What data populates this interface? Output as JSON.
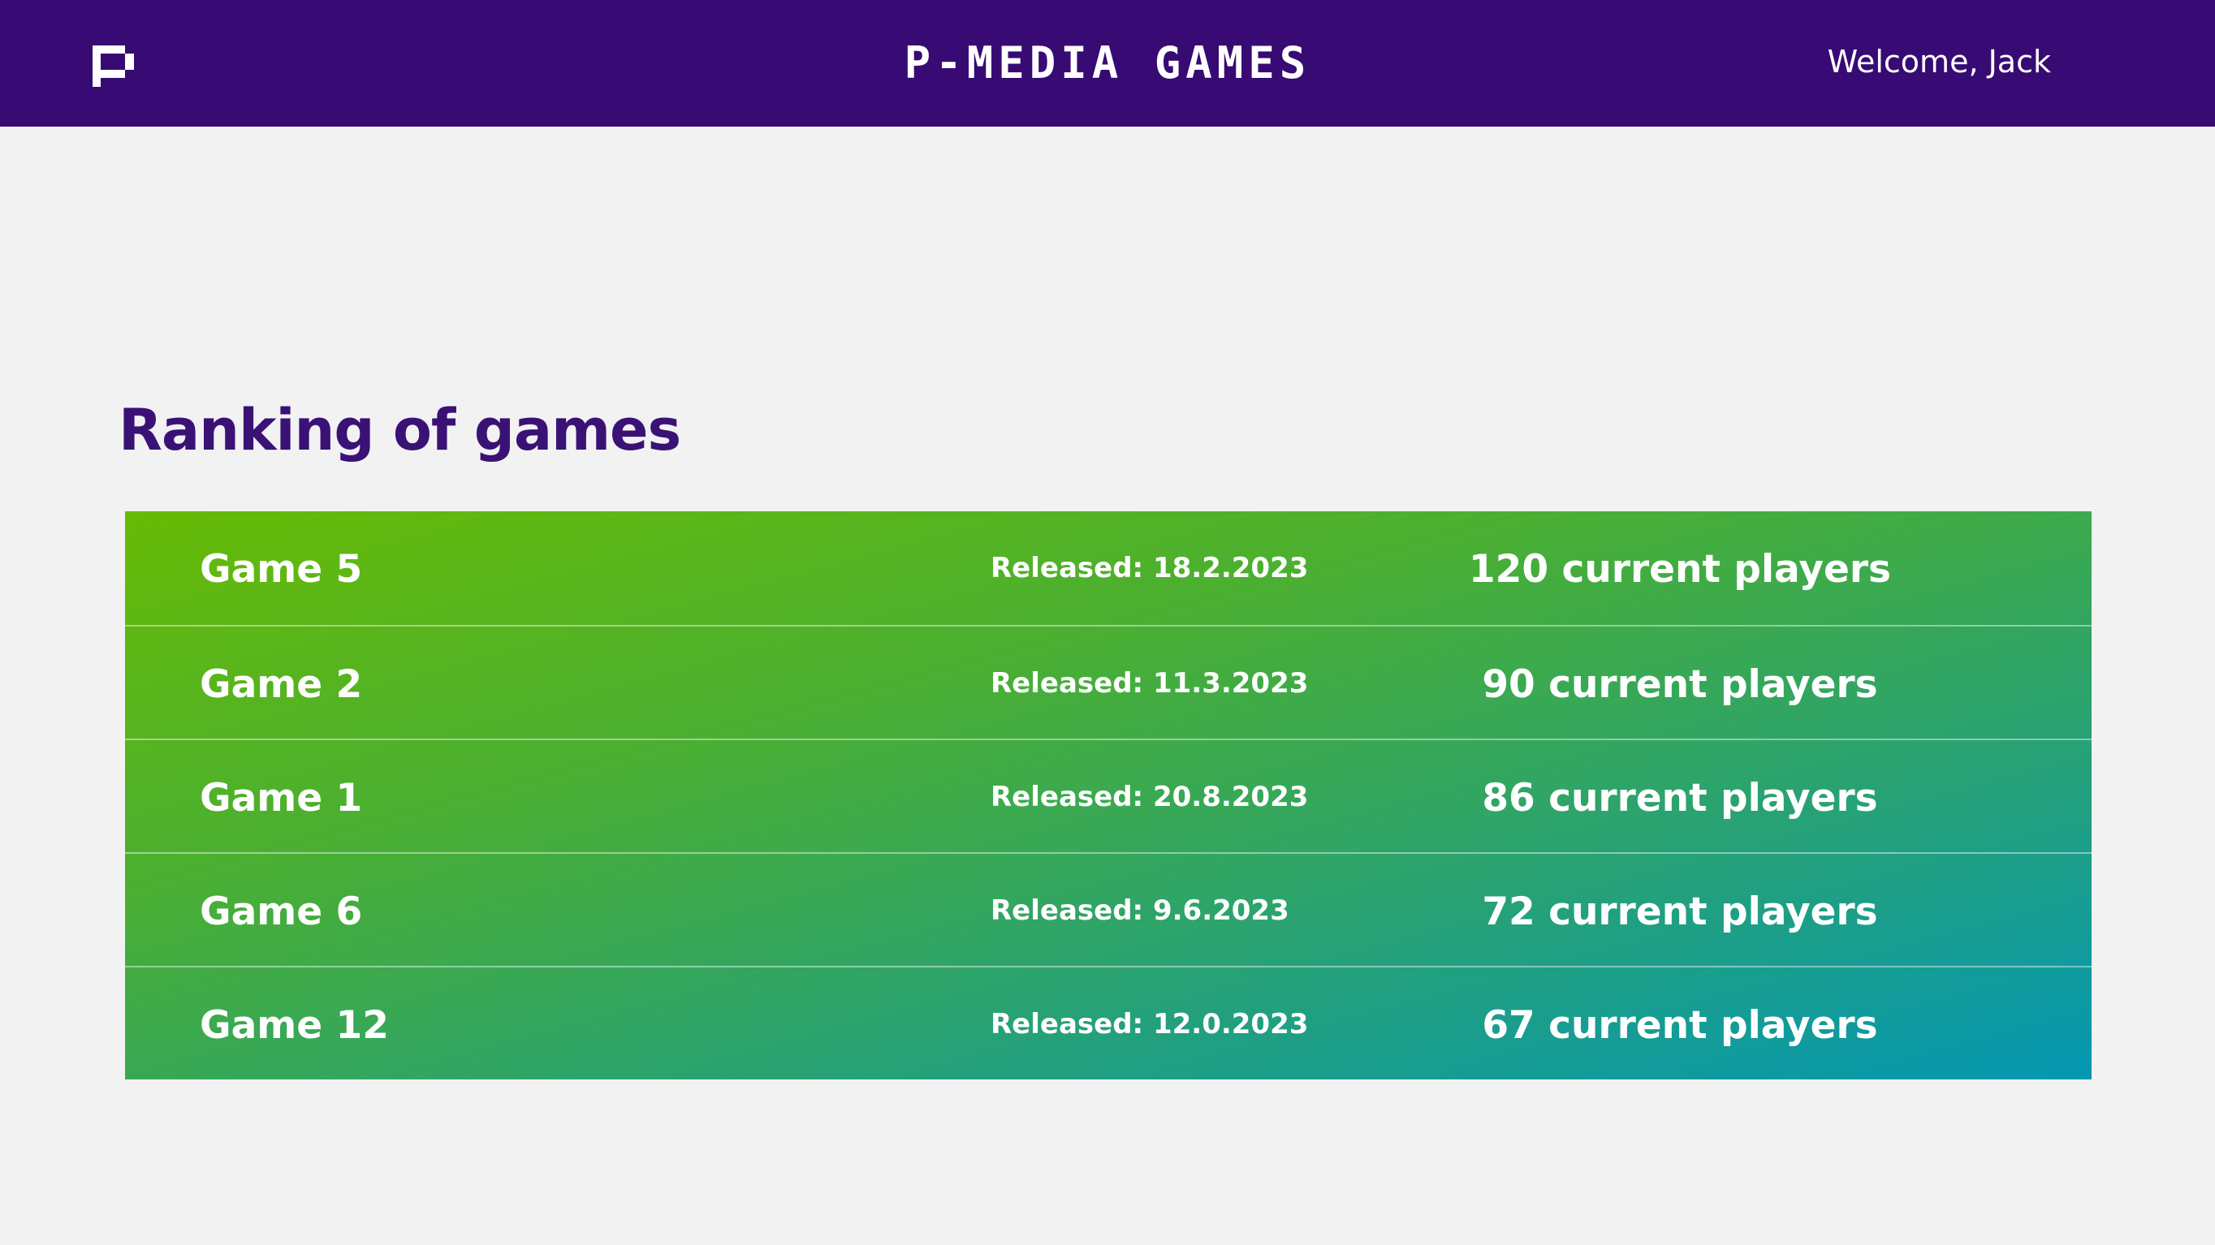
{
  "header": {
    "logo_icon": "p-logo-icon",
    "brand": "P-MEDIA GAMES",
    "welcome": "Welcome, Jack"
  },
  "main": {
    "title": "Ranking of games",
    "colors": {
      "header_bg": "#370b73",
      "title": "#3a1276",
      "gradient_top": "#67bb05",
      "gradient_bottom": "#0497b2"
    },
    "games": [
      {
        "name": "Game 5",
        "released": "Released: 18.2.2023",
        "players": "120 current players"
      },
      {
        "name": "Game 2",
        "released": "Released: 11.3.2023",
        "players": "90 current players"
      },
      {
        "name": "Game 1",
        "released": "Released: 20.8.2023",
        "players": "86 current players"
      },
      {
        "name": "Game 6",
        "released": "Released: 9.6.2023",
        "players": "72 current players"
      },
      {
        "name": "Game 12",
        "released": "Released: 12.0.2023",
        "players": "67 current players"
      }
    ]
  }
}
